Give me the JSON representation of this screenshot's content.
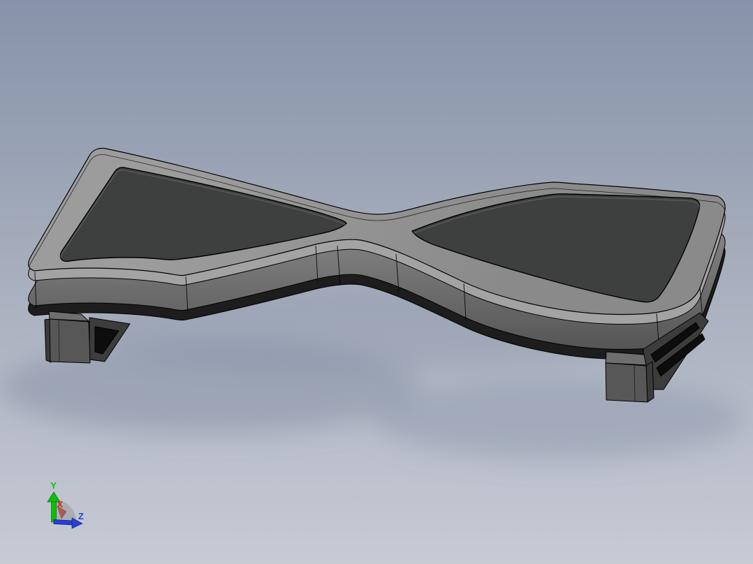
{
  "background": {
    "top": "#8793A9",
    "middle": "#A8AFBE",
    "bottom": "#C6CBD4"
  },
  "model": {
    "colors": {
      "top_face": "#949494",
      "chamfer_band": "#A3A3A3",
      "foot_pad": "#3E3F3F",
      "pad_inner_line": "#5A5B5B",
      "side_wall_top": "#828282",
      "side_wall_bottom": "#454545",
      "under_edge": "#1D1D1D",
      "leg_front": "#575757",
      "leg_top": "#6E6E6E",
      "leg_side": "#3B3B3B",
      "rail": "#3C3C3C",
      "rail_slot": "#0D0D0D",
      "edge_line": "#000000",
      "shadow": "#8590A6"
    }
  },
  "axis_triad": {
    "x": {
      "label": "X",
      "color": "#C8281E"
    },
    "y": {
      "label": "Y",
      "color": "#0FBE0F"
    },
    "z": {
      "label": "Z",
      "color": "#2A3FD4"
    }
  }
}
